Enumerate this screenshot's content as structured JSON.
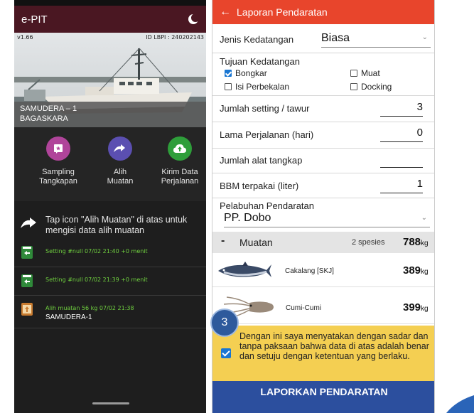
{
  "left_app": {
    "title": "e-PIT",
    "version": "v1.66",
    "id_lbpi": "ID LBPI : 240202143",
    "ship_name_1": "SAMUDERA – 1",
    "ship_name_2": "BAGASKARA",
    "actions": [
      {
        "label_1": "Sampling",
        "label_2": "Tangkapan",
        "icon": "star-document-icon",
        "color": "#b0449a"
      },
      {
        "label_1": "Alih",
        "label_2": "Muatan",
        "icon": "transfer-arrows-icon",
        "color": "#5b4fb1"
      },
      {
        "label_1": "Kirim Data",
        "label_2": "Perjalanan",
        "icon": "cloud-upload-icon",
        "color": "#2e9e3a"
      }
    ],
    "hint": "Tap icon \"Alih Muatan\" di atas untuk mengisi data alih muatan",
    "logs": [
      {
        "meta": "Setting #null 07/02 21:40 +0 menit",
        "sub": ""
      },
      {
        "meta": "Setting #null 07/02 21:39 +0 menit",
        "sub": ""
      },
      {
        "meta": "Alih muatan 56 kg 07/02 21:38",
        "sub": "SAMUDERA-1"
      }
    ]
  },
  "right_app": {
    "title": "Laporan Pendaratan",
    "jenis_label": "Jenis Kedatangan",
    "jenis_value": "Biasa",
    "tujuan_label": "Tujuan Kedatangan",
    "tujuan_options": [
      {
        "label": "Bongkar",
        "checked": true
      },
      {
        "label": "Muat",
        "checked": false
      },
      {
        "label": "Isi Perbekalan",
        "checked": false
      },
      {
        "label": "Docking",
        "checked": false
      }
    ],
    "fields": [
      {
        "label": "Jumlah setting / tawur",
        "value": "3"
      },
      {
        "label": "Lama Perjalanan (hari)",
        "value": "0"
      },
      {
        "label": "Jumlah alat tangkap",
        "value": ""
      },
      {
        "label": "BBM terpakai (liter)",
        "value": "1"
      }
    ],
    "pelabuhan_label": "Pelabuhan Pendaratan",
    "pelabuhan_value": "PP. Dobo",
    "muatan": {
      "collapse_symbol": "-",
      "label": "Muatan",
      "species_count": "2 spesies",
      "total_value": "788",
      "total_unit": "kg"
    },
    "fish": [
      {
        "name": "Cakalang [SKJ]",
        "value": "389",
        "unit": "kg"
      },
      {
        "name": "Cumi-Cumi",
        "value": "399",
        "unit": "kg"
      }
    ],
    "consent": "Dengan ini saya menyatakan dengan sadar dan tanpa paksaan bahwa data di atas adalah benar dan setuju dengan ketentuan yang berlaku.",
    "submit_label": "LAPORKAN PENDARATAN"
  },
  "step_badge": "3"
}
